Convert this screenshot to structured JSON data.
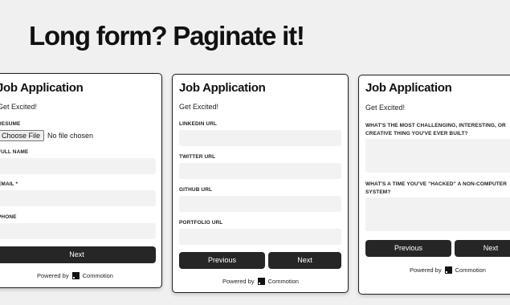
{
  "headline": "Long form? Paginate it!",
  "cards": [
    {
      "title": "Job Application",
      "subtitle": "Get Excited!",
      "resume_label": "RESUME",
      "file_button": "Choose File",
      "file_status": "No file chosen",
      "fields": [
        "FULL NAME",
        "EMAIL *",
        "PHONE"
      ],
      "next": "Next",
      "powered_by": "Powered by",
      "brand": "Commotion"
    },
    {
      "title": "Job Application",
      "subtitle": "Get Excited!",
      "fields": [
        "LINKEDIN URL",
        "TWITTER URL",
        "GITHUB URL",
        "PORTFOLIO URL"
      ],
      "previous": "Previous",
      "next": "Next",
      "powered_by": "Powered by",
      "brand": "Commotion"
    },
    {
      "title": "Job Application",
      "subtitle": "Get Excited!",
      "fields": [
        "WHAT'S THE MOST CHALLENGING, INTERESTING, OR CREATIVE THING YOU'VE EVER BUILT?",
        "WHAT'S A TIME YOU'VE \"HACKED\" A NON-COMPUTER SYSTEM?"
      ],
      "previous": "Previous",
      "next": "Next",
      "powered_by": "Powered by",
      "brand": "Commotion"
    }
  ],
  "colors": {
    "background": "#f0f0f0",
    "card": "#ffffff",
    "button": "#262626",
    "input": "#f2f2f2"
  }
}
